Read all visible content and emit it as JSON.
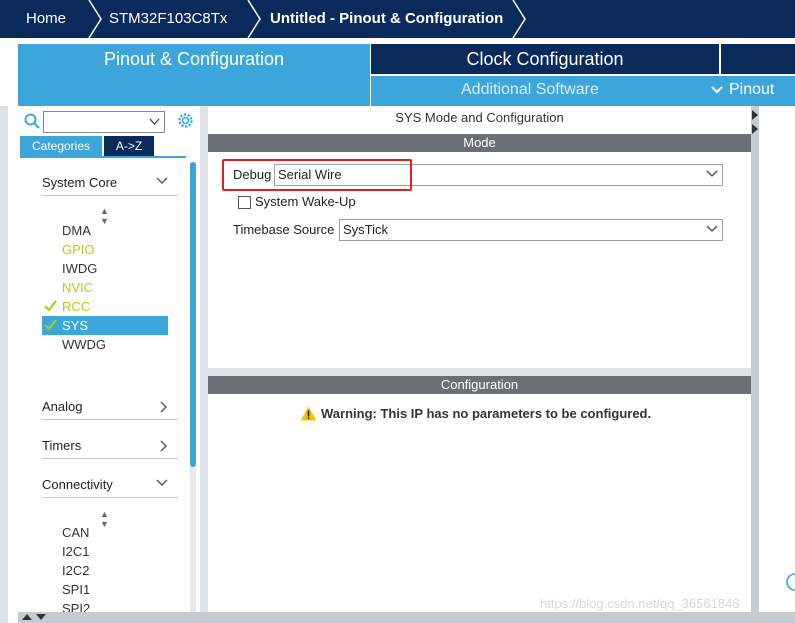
{
  "breadcrumb": {
    "home": "Home",
    "device": "STM32F103C8Tx",
    "current": "Untitled - Pinout & Configuration"
  },
  "tabs": {
    "pinout": "Pinout & Configuration",
    "clock": "Clock Configuration",
    "additional": "Additional Software",
    "pinout_menu": "Pinout"
  },
  "left": {
    "category_tab": "Categories",
    "az_tab": "A->Z",
    "system_core": "System Core",
    "system_items": [
      {
        "label": "DMA",
        "checked": false,
        "color": "dark"
      },
      {
        "label": "GPIO",
        "checked": false,
        "color": "yellow"
      },
      {
        "label": "IWDG",
        "checked": false,
        "color": "dark"
      },
      {
        "label": "NVIC",
        "checked": false,
        "color": "yellow"
      },
      {
        "label": "RCC",
        "checked": true,
        "color": "yellow"
      },
      {
        "label": "SYS",
        "checked": true,
        "color": "selected"
      },
      {
        "label": "WWDG",
        "checked": false,
        "color": "dark"
      }
    ],
    "analog": "Analog",
    "timers": "Timers",
    "connectivity": "Connectivity",
    "connectivity_items": [
      "CAN",
      "I2C1",
      "I2C2",
      "SPI1",
      "SPI2"
    ]
  },
  "main": {
    "title": "SYS Mode and Configuration",
    "mode_band": "Mode",
    "debug_label": "Debug",
    "debug_value": "Serial Wire",
    "wakeup_label": "System Wake-Up",
    "timebase_label": "Timebase Source",
    "timebase_value": "SysTick",
    "config_band": "Configuration",
    "warning": "Warning: This IP has no parameters to be configured."
  },
  "watermark": "https://blog.csdn.net/qq_36561846",
  "colors": {
    "navy": "#0b2a5c",
    "accent": "#3ca6db",
    "warning": "#f5c400",
    "highlight": "#e02020"
  }
}
